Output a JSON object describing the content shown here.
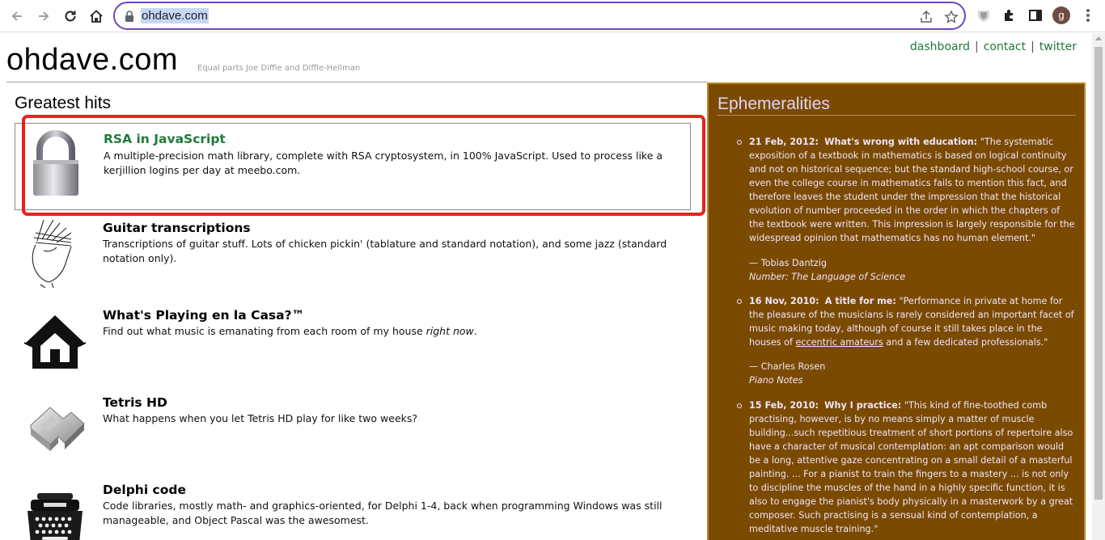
{
  "browser": {
    "url": "ohdave.com",
    "avatar_letter": "g"
  },
  "site": {
    "title": "ohdave.com",
    "tagline": "Equal parts Joe Diffie and Diffie-Hellman",
    "nav": [
      "dashboard",
      "contact",
      "twitter"
    ]
  },
  "hits": {
    "heading": "Greatest hits",
    "items": [
      {
        "title": "RSA in JavaScript",
        "desc": "A multiple-precision math library, complete with RSA cryptosystem, in 100% JavaScript. Used to process like a kerjillion logins per day at meebo.com.",
        "icon": "padlock-icon"
      },
      {
        "title": "Guitar transcriptions",
        "desc": "Transcriptions of guitar stuff. Lots of chicken pickin' (tablature and standard notation), and some jazz (standard notation only).",
        "icon": "guitar-hand-icon"
      },
      {
        "title": "What's Playing en la Casa?™",
        "desc_pre": "Find out what music is emanating from each room of my house ",
        "desc_em": "right now",
        "desc_post": ".",
        "icon": "house-icon"
      },
      {
        "title": "Tetris HD",
        "desc": "What happens when you let Tetris HD play for like two weeks?",
        "icon": "tetris-block-icon"
      },
      {
        "title": "Delphi code",
        "desc": "Code libraries, mostly math- and graphics-oriented, for Delphi 1-4, back when programming Windows was still manageable, and Object Pascal was the awesomest.",
        "icon": "typewriter-icon"
      }
    ]
  },
  "sidebar": {
    "heading": "Ephemeralities",
    "entries": [
      {
        "date": "21 Feb, 2012:",
        "headline": "What's wrong with education:",
        "text": "\"The systematic exposition of a textbook in mathematics is based on logical continuity and not on historical sequence; but the standard high-school course, or even the college course in mathematics fails to mention this fact, and therefore leaves the student under the impression that the historical evolution of number proceeded in the order in which the chapters of the textbook were written. This impression is largely responsible for the widespread opinion that mathematics has no human element.\"",
        "author": "— Tobias Dantzig",
        "source": "Number: The Language of Science"
      },
      {
        "date": "16 Nov, 2010:",
        "headline": "A title for me:",
        "text_pre": "\"Performance in private at home for the pleasure of the musicians is rarely considered an important facet of music making today, although of course it still takes place in the houses of ",
        "link": "eccentric amateurs",
        "text_post": " and a few dedicated professionals.\"",
        "author": "— Charles Rosen",
        "source": "Piano Notes"
      },
      {
        "date": "15 Feb, 2010:",
        "headline": "Why I practice:",
        "text": "\"This kind of fine-toothed comb practising, however, is by no means simply a matter of muscle building...such repetitious treatment of short portions of repertoire also have a character of musical contemplation: an apt comparison would be a long, attentive gaze concentrating on a small detail of a masterful painting. ... For a pianist to train the fingers to a mastery ... is not only to discipline the muscles of the hand in a highly specific function, it is also to engage the pianist's body physically in a masterwork by a great composer. Such practising is a sensual kind of contemplation, a meditative muscle training.\""
      }
    ]
  },
  "colors": {
    "link_green": "#1f7a3a",
    "sidebar_bg": "#7a4a00",
    "sidebar_border": "#c08a2a",
    "highlight_red": "#e8221f"
  }
}
